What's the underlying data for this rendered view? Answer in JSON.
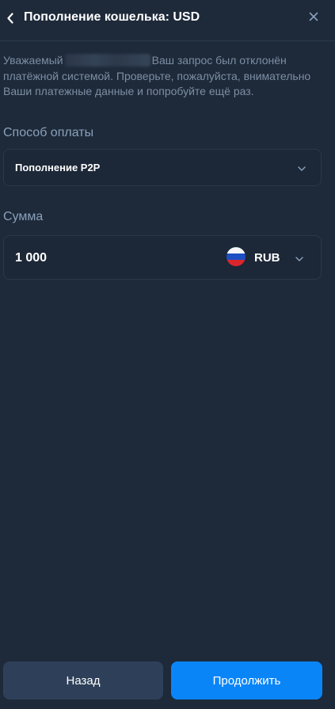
{
  "header": {
    "title": "Пополнение кошелька: USD",
    "back_icon": "chevron-left-icon",
    "close_icon": "close-icon"
  },
  "message": {
    "greeting": "Уважаемый",
    "text": "Ваш запрос был отклонён платёжной системой. Проверьте, пожалуйста, внимательно Ваши платежные данные и попробуйте ещё раз."
  },
  "payment_method": {
    "label": "Способ оплаты",
    "selected": "Пополнение P2P"
  },
  "amount": {
    "label": "Сумма",
    "value": "1 000",
    "currency": "RUB",
    "flag_icon": "russia-flag-icon"
  },
  "buttons": {
    "back_label": "Назад",
    "continue_label": "Продолжить"
  },
  "colors": {
    "background": "#1e2a3a",
    "accent": "#0a85f8",
    "secondary_button": "#2e4059",
    "muted_text": "#7d8ea4",
    "label_text": "#8aa0bb"
  }
}
